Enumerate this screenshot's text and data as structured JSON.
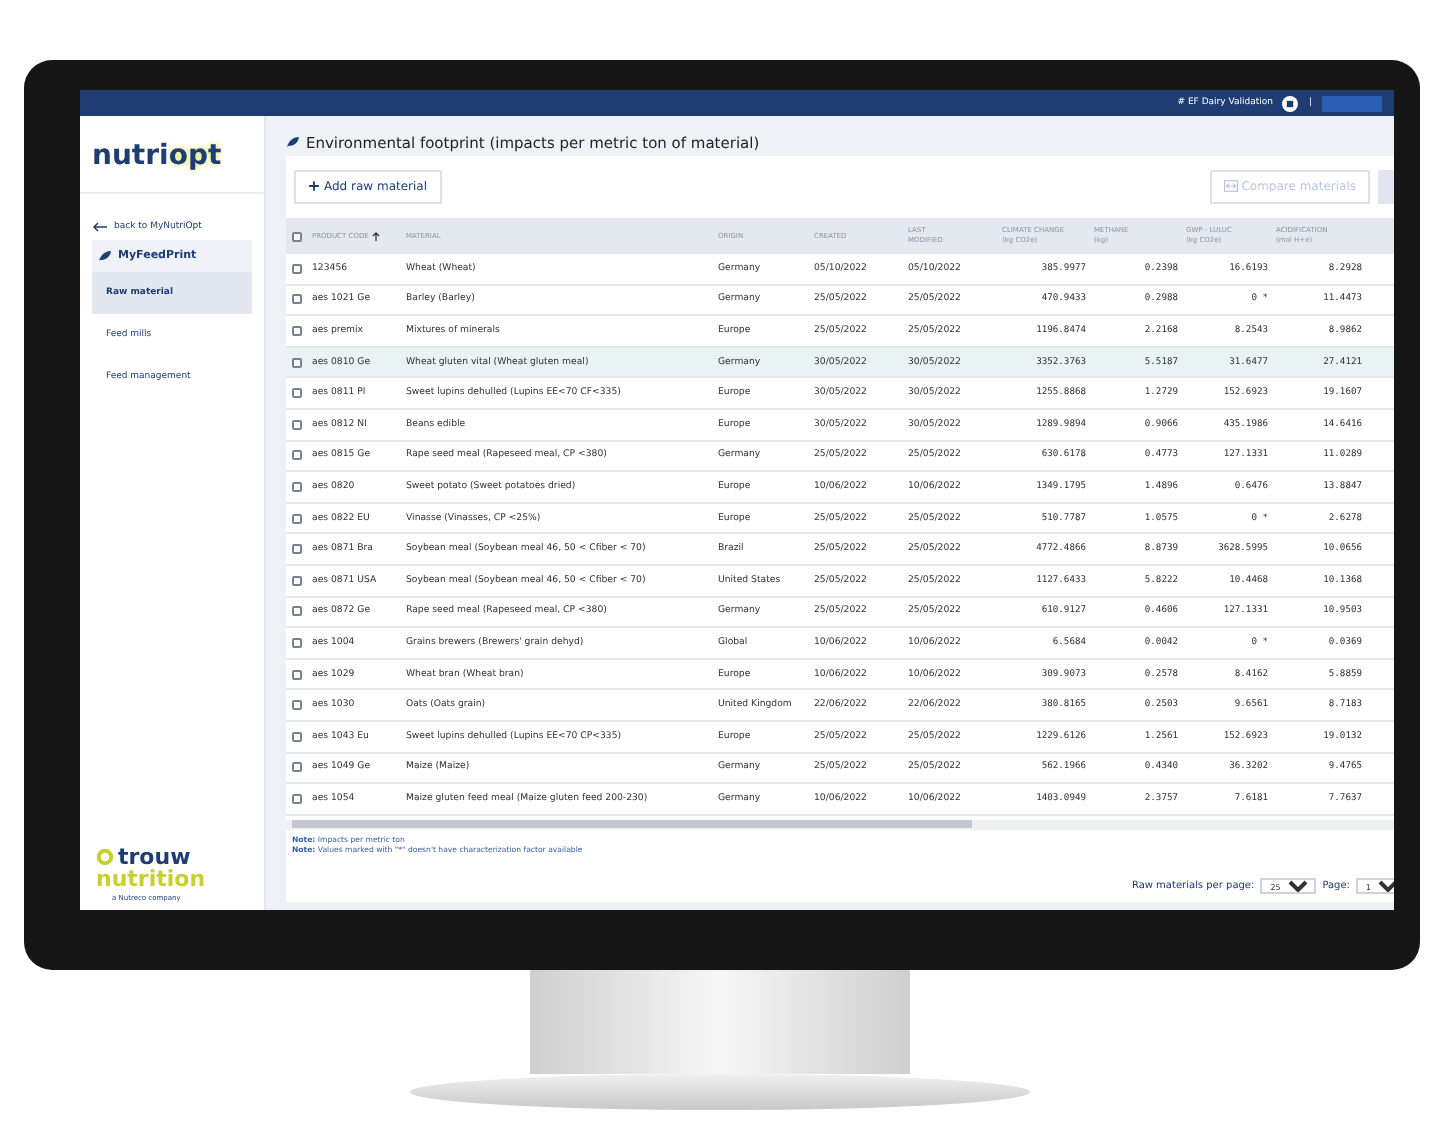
{
  "top_bar": {
    "workspace": "# EF Dairy Validation",
    "separator": "|"
  },
  "sidebar": {
    "logo_parts": [
      "nutri",
      "opt"
    ],
    "back_link": "back to MyNutriOpt",
    "section": "MyFeedPrint",
    "items": [
      {
        "label": "Raw material",
        "selected": true
      },
      {
        "label": "Feed mills",
        "selected": false
      },
      {
        "label": "Feed management",
        "selected": false
      }
    ],
    "footer_logo": {
      "name_parts": [
        "trouw",
        "nutrition"
      ],
      "tagline": "a Nutreco company"
    }
  },
  "page_title": "Environmental footprint (impacts per metric ton of material)",
  "add_button": "Add raw material",
  "compare_button": {
    "label": "Compare materials",
    "disabled": true
  },
  "table": {
    "select_all_checked": false,
    "columns": [
      {
        "label": "PRODUCT CODE"
      },
      {
        "label": "MATERIAL"
      },
      {
        "label": "ORIGIN"
      },
      {
        "label": "CREATED"
      },
      {
        "label": "LAST",
        "sub": "MODIFIED"
      },
      {
        "label": "CLIMATE CHANGE",
        "sub": "(kg CO2e)"
      },
      {
        "label": "METHANE",
        "sub": "(kg)"
      },
      {
        "label": "GWP - LULUC",
        "sub": "(kg CO2e)"
      },
      {
        "label": "ACIDIFICATION",
        "sub": "(mol H+e)"
      }
    ],
    "rows": [
      {
        "checked": false,
        "highlighted": false,
        "cells": [
          "123456",
          "Wheat (Wheat)",
          "Germany",
          "05/10/2022",
          "05/10/2022",
          "385.9977",
          "0.2398",
          "16.6193",
          "8.2928"
        ]
      },
      {
        "checked": false,
        "highlighted": false,
        "cells": [
          "aes 1021 Ge",
          "Barley (Barley)",
          "Germany",
          "25/05/2022",
          "25/05/2022",
          "470.9433",
          "0.2988",
          "0 *",
          "11.4473"
        ]
      },
      {
        "checked": false,
        "highlighted": false,
        "cells": [
          "aes premix",
          "Mixtures of minerals",
          "Europe",
          "25/05/2022",
          "25/05/2022",
          "1196.8474",
          "2.2168",
          "8.2543",
          "8.9862"
        ]
      },
      {
        "checked": false,
        "highlighted": true,
        "cells": [
          "aes 0810 Ge",
          "Wheat gluten vital (Wheat gluten meal)",
          "Germany",
          "30/05/2022",
          "30/05/2022",
          "3352.3763",
          "5.5187",
          "31.6477",
          "27.4121"
        ]
      },
      {
        "checked": false,
        "highlighted": false,
        "cells": [
          "aes 0811 Pl",
          "Sweet lupins dehulled (Lupins EE<70 CF<335)",
          "Europe",
          "30/05/2022",
          "30/05/2022",
          "1255.8868",
          "1.2729",
          "152.6923",
          "19.1607"
        ]
      },
      {
        "checked": false,
        "highlighted": false,
        "cells": [
          "aes 0812 Nl",
          "Beans edible",
          "Europe",
          "30/05/2022",
          "30/05/2022",
          "1289.9894",
          "0.9066",
          "435.1986",
          "14.6416"
        ]
      },
      {
        "checked": false,
        "highlighted": false,
        "cells": [
          "aes 0815 Ge",
          "Rape seed meal (Rapeseed meal, CP <380)",
          "Germany",
          "25/05/2022",
          "25/05/2022",
          "630.6178",
          "0.4773",
          "127.1331",
          "11.0289"
        ]
      },
      {
        "checked": false,
        "highlighted": false,
        "cells": [
          "aes 0820",
          "Sweet potato (Sweet potatoes dried)",
          "Europe",
          "10/06/2022",
          "10/06/2022",
          "1349.1795",
          "1.4896",
          "0.6476",
          "13.8847"
        ]
      },
      {
        "checked": false,
        "highlighted": false,
        "cells": [
          "aes 0822 EU",
          "Vinasse (Vinasses, CP <25%)",
          "Europe",
          "25/05/2022",
          "25/05/2022",
          "510.7787",
          "1.0575",
          "0 *",
          "2.6278"
        ]
      },
      {
        "checked": false,
        "highlighted": false,
        "cells": [
          "aes 0871 Bra",
          "Soybean meal (Soybean meal 46, 50 < Cfiber < 70)",
          "Brazil",
          "25/05/2022",
          "25/05/2022",
          "4772.4866",
          "8.8739",
          "3628.5995",
          "10.0656"
        ]
      },
      {
        "checked": false,
        "highlighted": false,
        "cells": [
          "aes 0871 USA",
          "Soybean meal (Soybean meal 46, 50 < Cfiber < 70)",
          "United States",
          "25/05/2022",
          "25/05/2022",
          "1127.6433",
          "5.8222",
          "10.4468",
          "10.1368"
        ]
      },
      {
        "checked": false,
        "highlighted": false,
        "cells": [
          "aes 0872 Ge",
          "Rape seed meal (Rapeseed meal, CP <380)",
          "Germany",
          "25/05/2022",
          "25/05/2022",
          "610.9127",
          "0.4606",
          "127.1331",
          "10.9503"
        ]
      },
      {
        "checked": false,
        "highlighted": false,
        "cells": [
          "aes 1004",
          "Grains brewers (Brewers' grain dehyd)",
          "Global",
          "10/06/2022",
          "10/06/2022",
          "6.5684",
          "0.0042",
          "0 *",
          "0.0369"
        ]
      },
      {
        "checked": false,
        "highlighted": false,
        "cells": [
          "aes 1029",
          "Wheat bran (Wheat bran)",
          "Europe",
          "10/06/2022",
          "10/06/2022",
          "309.9073",
          "0.2578",
          "8.4162",
          "5.8859"
        ]
      },
      {
        "checked": false,
        "highlighted": false,
        "cells": [
          "aes 1030",
          "Oats (Oats grain)",
          "United Kingdom",
          "22/06/2022",
          "22/06/2022",
          "380.8165",
          "0.2503",
          "9.6561",
          "8.7183"
        ]
      },
      {
        "checked": false,
        "highlighted": false,
        "cells": [
          "aes 1043 Eu",
          "Sweet lupins dehulled (Lupins EE<70 CP<335)",
          "Europe",
          "25/05/2022",
          "25/05/2022",
          "1229.6126",
          "1.2561",
          "152.6923",
          "19.0132"
        ]
      },
      {
        "checked": false,
        "highlighted": false,
        "cells": [
          "aes 1049 Ge",
          "Maize (Maize)",
          "Germany",
          "25/05/2022",
          "25/05/2022",
          "562.1966",
          "0.4340",
          "36.3202",
          "9.4765"
        ]
      },
      {
        "checked": false,
        "highlighted": false,
        "cells": [
          "aes 1054",
          "Maize gluten feed meal (Maize gluten feed 200-230)",
          "Germany",
          "10/06/2022",
          "10/06/2022",
          "1403.0949",
          "2.3757",
          "7.6181",
          "7.7637"
        ]
      }
    ]
  },
  "notes": [
    "**Note:** Impacts per metric ton",
    "**Note:** Values marked with \"*\" doesn't have characterization factor available"
  ],
  "pagination": {
    "per_page_label": "Raw materials per page:",
    "per_page": "25",
    "page_label": "Page:",
    "page": "1"
  }
}
